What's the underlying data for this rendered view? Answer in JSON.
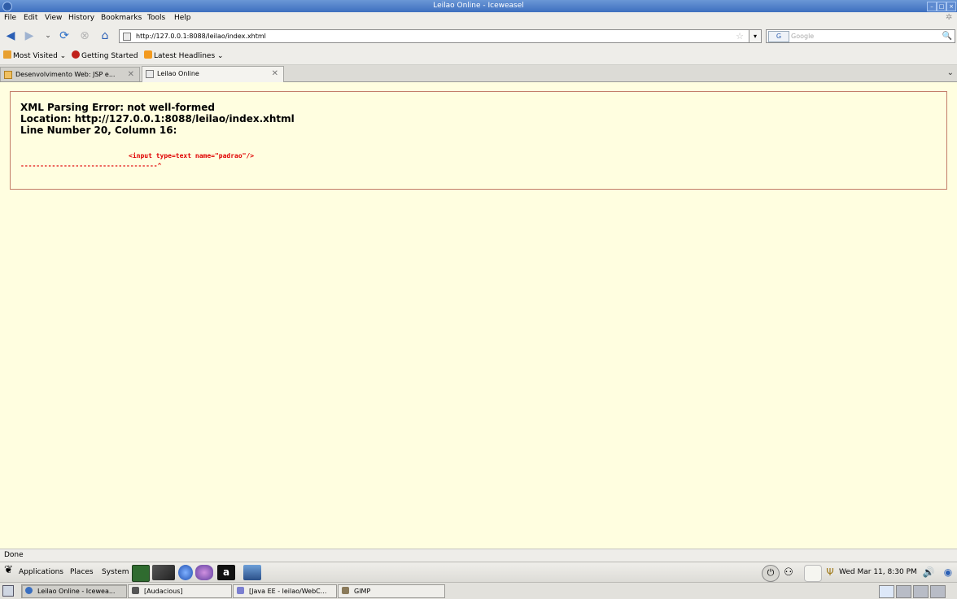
{
  "window": {
    "title": "Leilao Online - Iceweasel"
  },
  "menubar": {
    "items": [
      "File",
      "Edit",
      "View",
      "History",
      "Bookmarks",
      "Tools",
      "Help"
    ],
    "mnemonic_underline": [
      0,
      0,
      0,
      2,
      0,
      0,
      0
    ]
  },
  "navbar": {
    "url": "http://127.0.0.1:8088/leilao/index.xhtml",
    "search_engine": "G",
    "search_placeholder": "Google"
  },
  "bookmarks": {
    "items": [
      "Most Visited",
      "Getting Started",
      "Latest Headlines"
    ]
  },
  "tabs": [
    {
      "label": "Desenvolvimento Web: JSP e...",
      "active": false
    },
    {
      "label": "Leilao Online",
      "active": true
    }
  ],
  "error": {
    "title": "XML Parsing Error: not well-formed",
    "location": "Location: http://127.0.0.1:8088/leilao/index.xhtml",
    "line": "Line Number 20, Column 16:",
    "source": "<input type=text name=\"padrao\"/>",
    "pointer": "-----------------------------------^"
  },
  "status": {
    "text": "Done"
  },
  "panel": {
    "menus": [
      "Applications",
      "Places",
      "System"
    ],
    "clock": "Wed Mar 11,  8:30 PM"
  },
  "taskbar": {
    "tasks": [
      {
        "label": "Leilao Online - Icewea...",
        "active": true
      },
      {
        "label": "[Audacious]",
        "active": false
      },
      {
        "label": "[Java EE - leilao/WebC...",
        "active": false
      },
      {
        "label": "GIMP",
        "active": false
      }
    ]
  },
  "colors": {
    "titlebar": "#4a7dc9",
    "content_bg": "#fffee0",
    "error_border": "#c27c68",
    "source_text": "#e00000"
  }
}
